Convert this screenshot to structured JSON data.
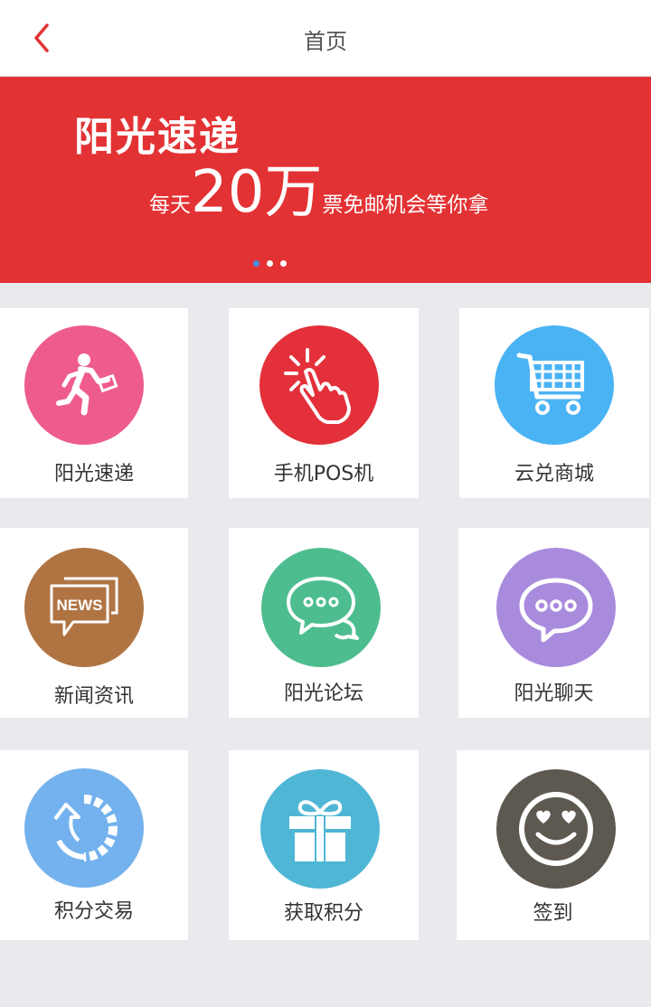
{
  "nav": {
    "title": "首页"
  },
  "banner": {
    "headline": "阳光速递",
    "sub_prefix": "每天",
    "sub_number": "20万",
    "sub_suffix": "票免邮机会等你拿"
  },
  "tiles": [
    {
      "label": "阳光速递",
      "icon": "runner-icon",
      "color": "#ee5b8e"
    },
    {
      "label": "手机POS机",
      "icon": "tap-hand-icon",
      "color": "#e3303a"
    },
    {
      "label": "云兑商城",
      "icon": "shopping-cart-icon",
      "color": "#4ab3f4"
    },
    {
      "label": "新闻资讯",
      "icon": "news-icon",
      "icon_text": "NEWS",
      "color": "#b07443"
    },
    {
      "label": "阳光论坛",
      "icon": "chat-bubbles-icon",
      "color": "#4dbd8f"
    },
    {
      "label": "阳光聊天",
      "icon": "chat-bubble-icon",
      "color": "#a98bde"
    },
    {
      "label": "积分交易",
      "icon": "exchange-icon",
      "color": "#73b2ee"
    },
    {
      "label": "获取积分",
      "icon": "gift-icon",
      "color": "#4fb6d6"
    },
    {
      "label": "签到",
      "icon": "smiley-heart-eyes-icon",
      "color": "#5d5850"
    }
  ]
}
